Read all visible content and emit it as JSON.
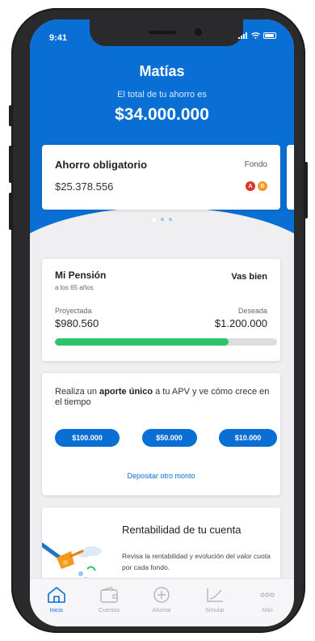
{
  "status_bar": {
    "time": "9:41"
  },
  "header": {
    "user_name": "Matías",
    "total_label": "El total de tu ahorro es",
    "total_amount": "$34.000.000"
  },
  "savings_card": {
    "title": "Ahorro obligatorio",
    "amount": "$25.378.556",
    "fund_label": "Fondo",
    "funds": [
      {
        "letter": "A",
        "color": "#e0342c"
      },
      {
        "letter": "B",
        "color": "#f39a1e"
      }
    ]
  },
  "pager": {
    "pages": 3,
    "active_index": 0
  },
  "pension_card": {
    "title": "Mi Pensión",
    "status": "Vas bien",
    "age_note": "a los 65 años",
    "projected_label": "Proyectada",
    "projected_value": "$980.560",
    "desired_label": "Deseada",
    "desired_value": "$1.200.000",
    "progress_fraction": 0.78
  },
  "apv_card": {
    "text_before": "Realiza un ",
    "text_bold": "aporte único",
    "text_after": " a tu APV y ve cómo crece en el tiempo",
    "amounts": [
      "$100.000",
      "$50.000",
      "$10.000"
    ],
    "deposit_link": "Depositar otro monto"
  },
  "rent_card": {
    "title": "Rentabilidad de tu cuenta",
    "description": "Revisa la rentabilidad y evolución del valor cuota por cada fondo."
  },
  "tabbar": {
    "tabs": [
      {
        "label": "Inicio",
        "icon": "home-icon",
        "active": true
      },
      {
        "label": "Cuentas",
        "icon": "wallet-icon",
        "active": false
      },
      {
        "label": "Ahorrar",
        "icon": "plus-circle-icon",
        "active": false
      },
      {
        "label": "Simular",
        "icon": "chart-icon",
        "active": false
      },
      {
        "label": "Más",
        "icon": "more-icon",
        "active": false
      }
    ]
  },
  "colors": {
    "primary": "#0a6fd4",
    "progress": "#2ec26a",
    "background": "#efeff1"
  }
}
